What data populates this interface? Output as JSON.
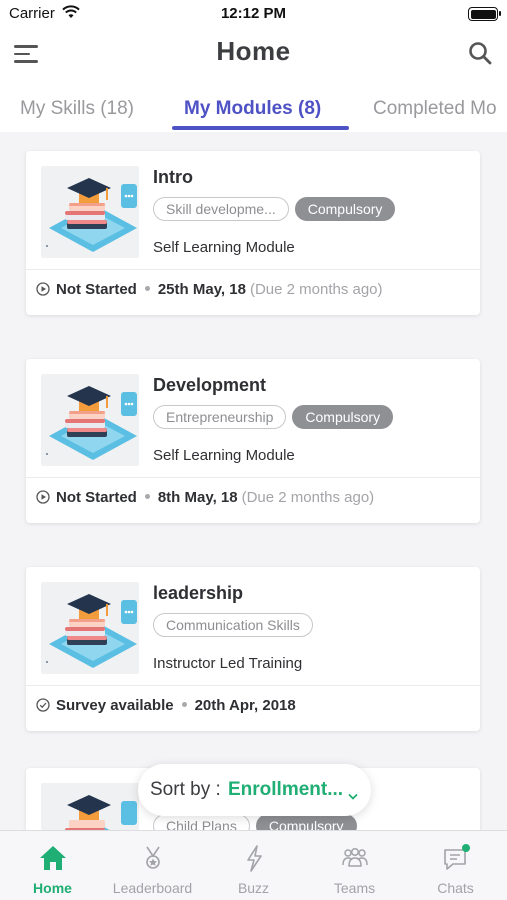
{
  "status_bar": {
    "carrier": "Carrier",
    "time": "12:12 PM"
  },
  "header": {
    "title": "Home"
  },
  "tabs": [
    {
      "label": "My Skills (18)"
    },
    {
      "label": "My Modules (8)"
    },
    {
      "label": "Completed Mo"
    }
  ],
  "modules": [
    {
      "name": "Intro",
      "tags": [
        "Skill developme...",
        "Compulsory"
      ],
      "type": "Self Learning Module",
      "status": "Not Started",
      "date": "25th May, 18",
      "due": "(Due 2 months ago)"
    },
    {
      "name": "Development",
      "tags": [
        "Entrepreneurship",
        "Compulsory"
      ],
      "type": "Self Learning Module",
      "status": "Not Started",
      "date": "8th May, 18",
      "due": "(Due 2 months ago)"
    },
    {
      "name": "leadership",
      "tags": [
        "Communication Skills"
      ],
      "type": "Instructor Led Training",
      "status": "Survey available",
      "date": "20th Apr, 2018",
      "due": ""
    },
    {
      "name": "",
      "tags": [
        "Child Plans",
        "Compulsory"
      ],
      "type": "",
      "status": "",
      "date": "",
      "due": ""
    }
  ],
  "sort": {
    "label": "Sort by :",
    "value": "Enrollment..."
  },
  "tabbar": [
    {
      "label": "Home",
      "icon": "home-icon"
    },
    {
      "label": "Leaderboard",
      "icon": "trophy-icon"
    },
    {
      "label": "Buzz",
      "icon": "bolt-icon"
    },
    {
      "label": "Teams",
      "icon": "team-icon"
    },
    {
      "label": "Chats",
      "icon": "chat-icon"
    }
  ],
  "colors": {
    "accent": "#4f52c4",
    "brand_green": "#1fae73",
    "compulsory_tag": "#8e9094"
  }
}
